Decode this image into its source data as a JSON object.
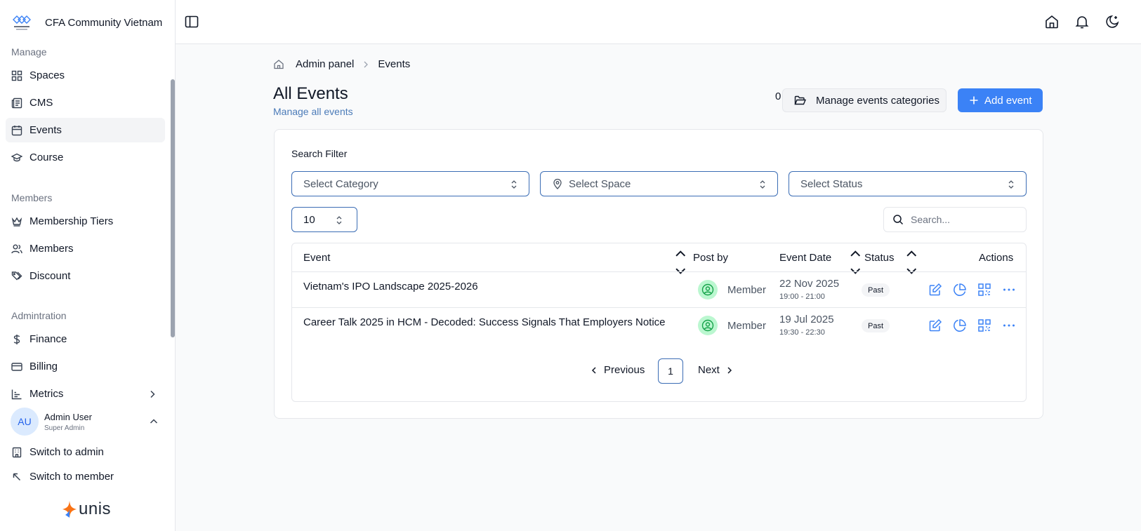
{
  "brand": {
    "name": "CFA Community Vietnam"
  },
  "sidebar": {
    "sections": [
      {
        "label": "Manage",
        "items": [
          {
            "label": "Spaces",
            "icon": "grid-icon"
          },
          {
            "label": "CMS",
            "icon": "newspaper-icon"
          },
          {
            "label": "Events",
            "icon": "calendar-icon",
            "active": true
          },
          {
            "label": "Course",
            "icon": "graduation-cap-icon"
          }
        ]
      },
      {
        "label": "Members",
        "items": [
          {
            "label": "Membership Tiers",
            "icon": "crown-icon"
          },
          {
            "label": "Members",
            "icon": "users-icon"
          },
          {
            "label": "Discount",
            "icon": "tags-icon"
          }
        ]
      },
      {
        "label": "Admintration",
        "items": [
          {
            "label": "Finance",
            "icon": "dollar-icon"
          },
          {
            "label": "Billing",
            "icon": "credit-card-icon"
          },
          {
            "label": "Metrics",
            "icon": "chart-icon"
          }
        ]
      }
    ],
    "user": {
      "initials": "AU",
      "name": "Admin User",
      "role": "Super Admin"
    },
    "switch_admin": "Switch to admin",
    "switch_member": "Switch to member",
    "powered_by": "unis"
  },
  "breadcrumb": {
    "parent": "Admin panel",
    "current": "Events"
  },
  "header": {
    "title": "All Events",
    "subtitle": "Manage all events",
    "stray_text": "0",
    "manage_categories_label": "Manage events categories",
    "add_event_label": "Add event"
  },
  "filters": {
    "title": "Search Filter",
    "category_placeholder": "Select Category",
    "space_placeholder": "Select Space",
    "status_placeholder": "Select Status",
    "page_size": "10",
    "search_placeholder": "Search..."
  },
  "table": {
    "columns": {
      "event": "Event",
      "post_by": "Post by",
      "event_date": "Event Date",
      "status": "Status",
      "actions": "Actions"
    },
    "rows": [
      {
        "event": "Vietnam's IPO Landscape 2025-2026",
        "post_by": "Member",
        "date": "22 Nov 2025",
        "time": "19:00 - 21:00",
        "status": "Past"
      },
      {
        "event": "Career Talk 2025 in HCM - Decoded: Success Signals That Employers Notice",
        "post_by": "Member",
        "date": "19 Jul 2025",
        "time": "19:30 - 22:30",
        "status": "Past"
      }
    ]
  },
  "pagination": {
    "previous": "Previous",
    "page": "1",
    "next": "Next"
  },
  "colors": {
    "accent": "#3b82f6",
    "border_active": "#3b6db5",
    "badge_bg": "#f3f4f6"
  }
}
